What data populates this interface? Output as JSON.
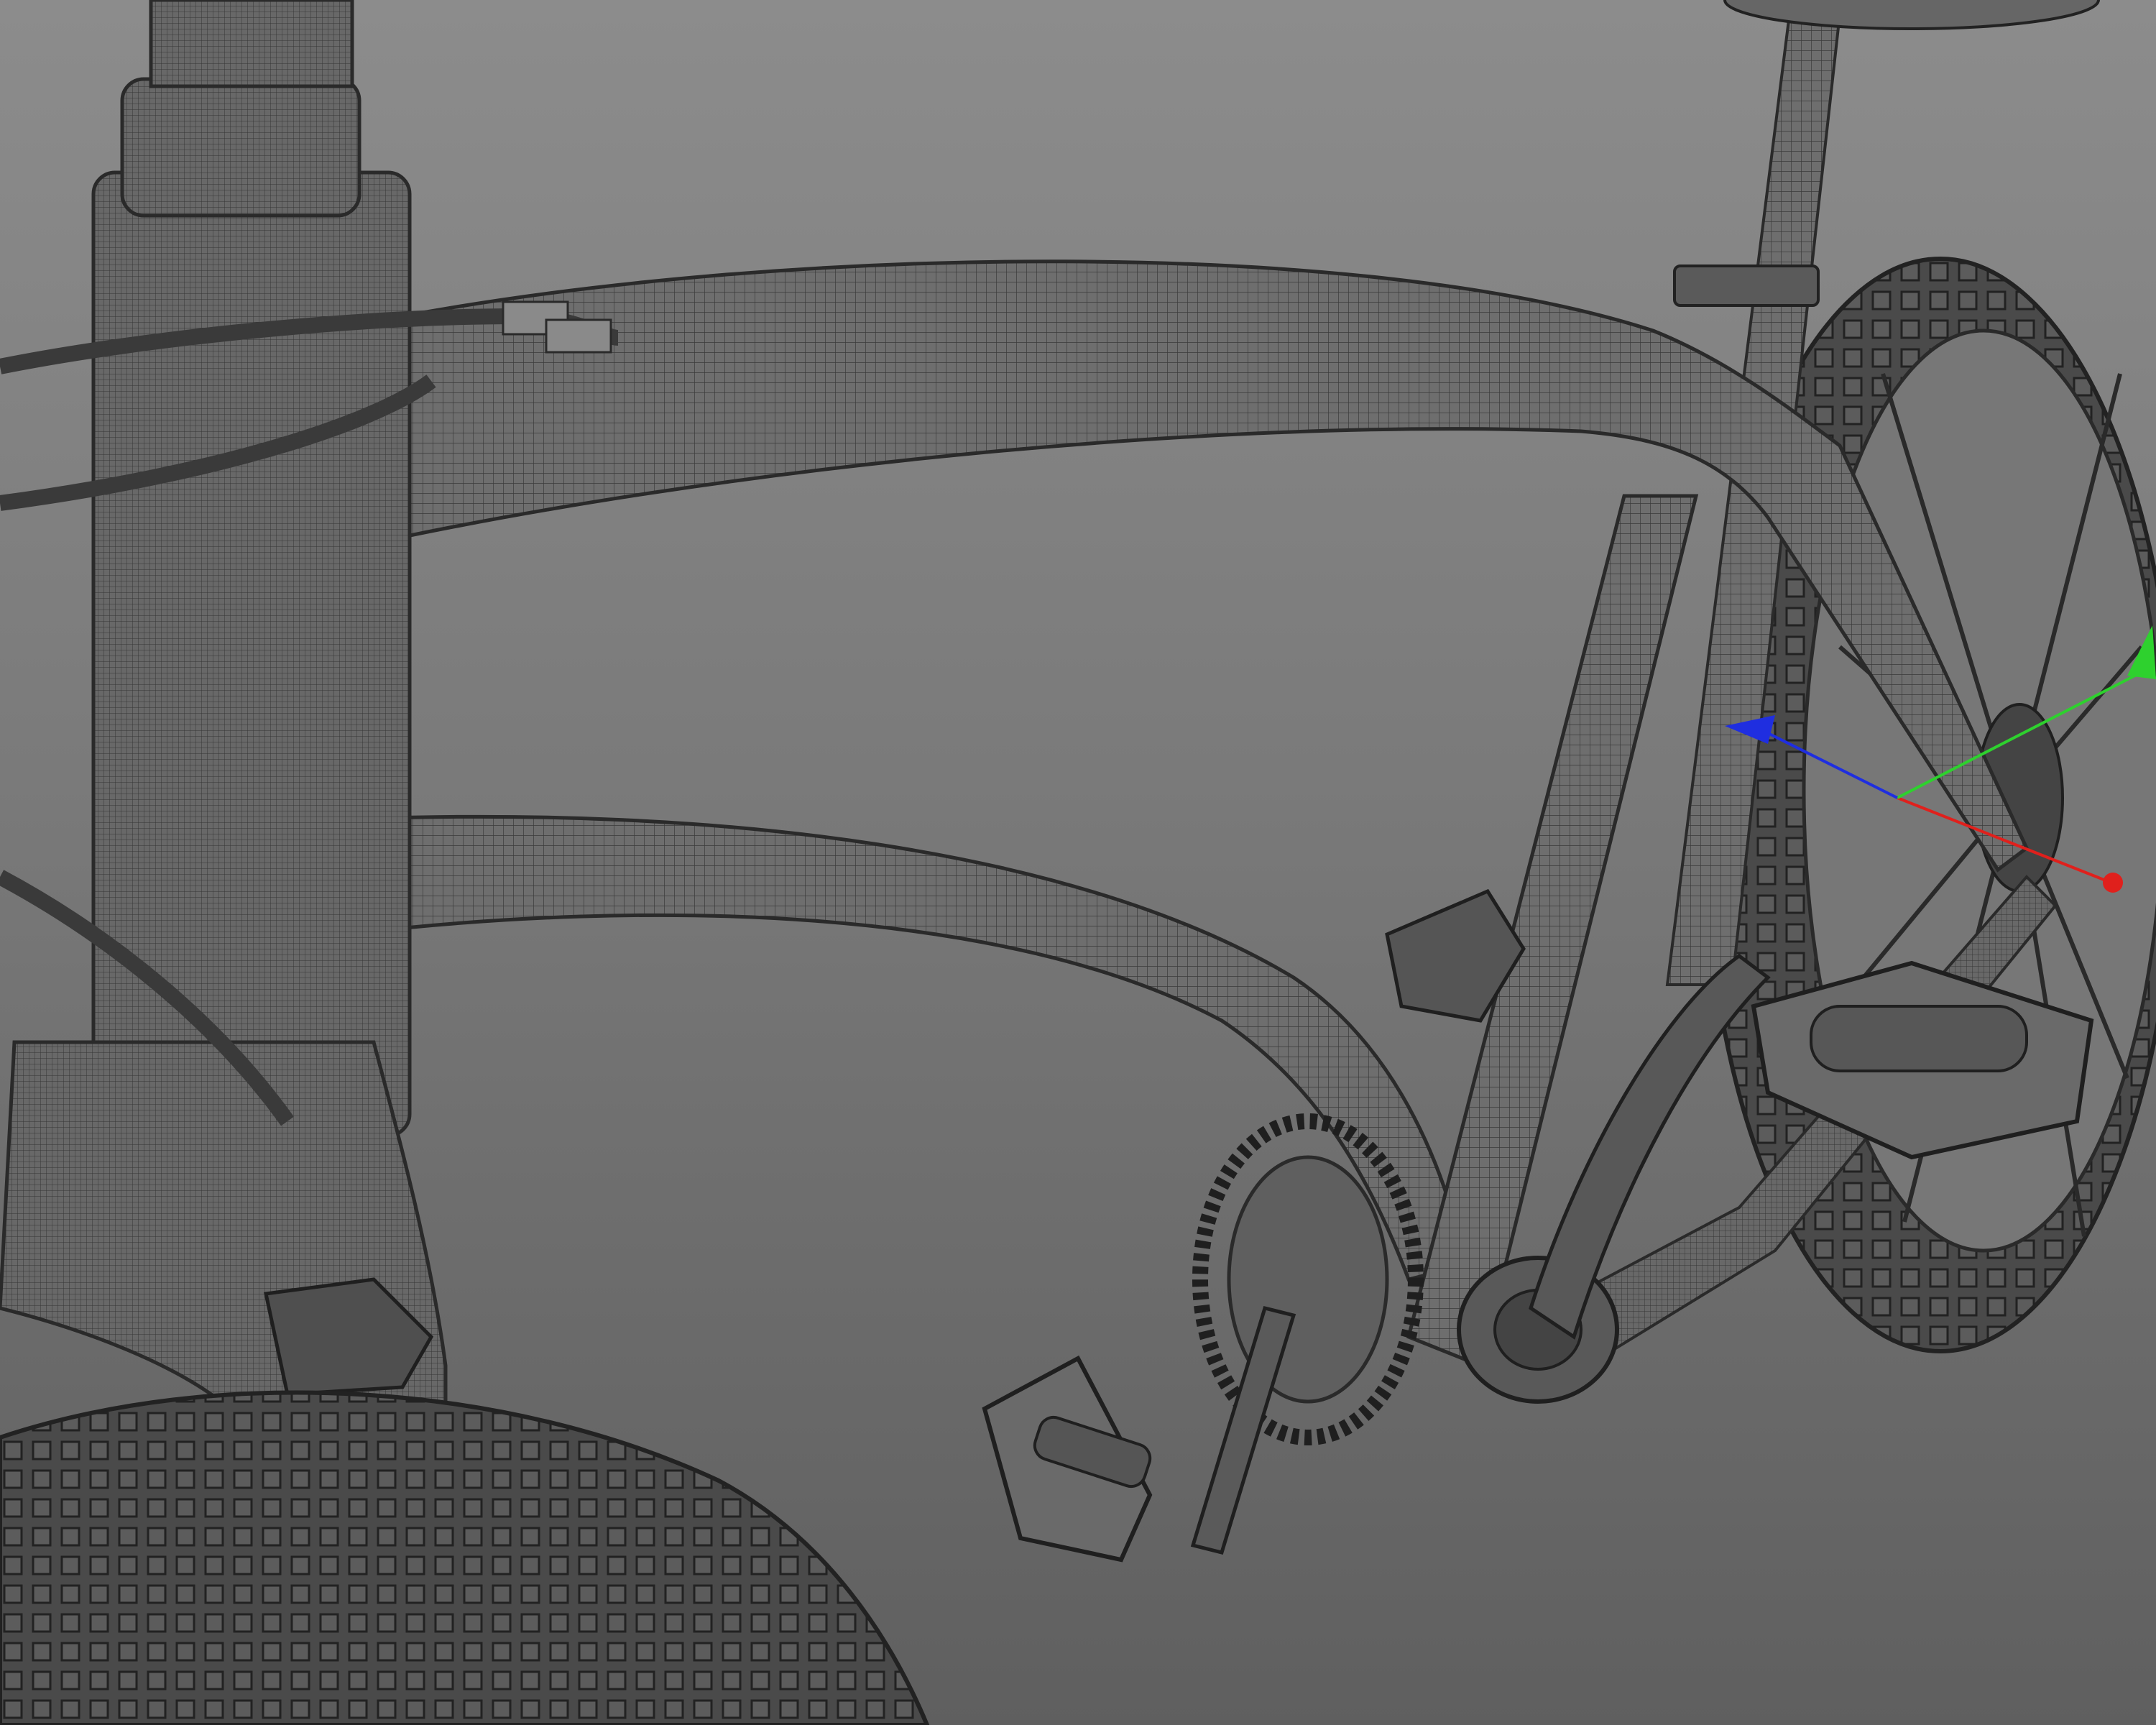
{
  "viewport": {
    "background_top": "#8c8c8c",
    "background_bottom": "#5f5f5f",
    "mesh_fill": "#6d6d6d",
    "wire_color": "#2e2e2e"
  },
  "gizmo": {
    "x_axis_color": "#e0201c",
    "y_axis_color": "#2ed12e",
    "z_axis_color": "#1f2ee0",
    "handles": [
      "x-axis-handle",
      "y-axis-handle",
      "z-axis-handle"
    ]
  }
}
